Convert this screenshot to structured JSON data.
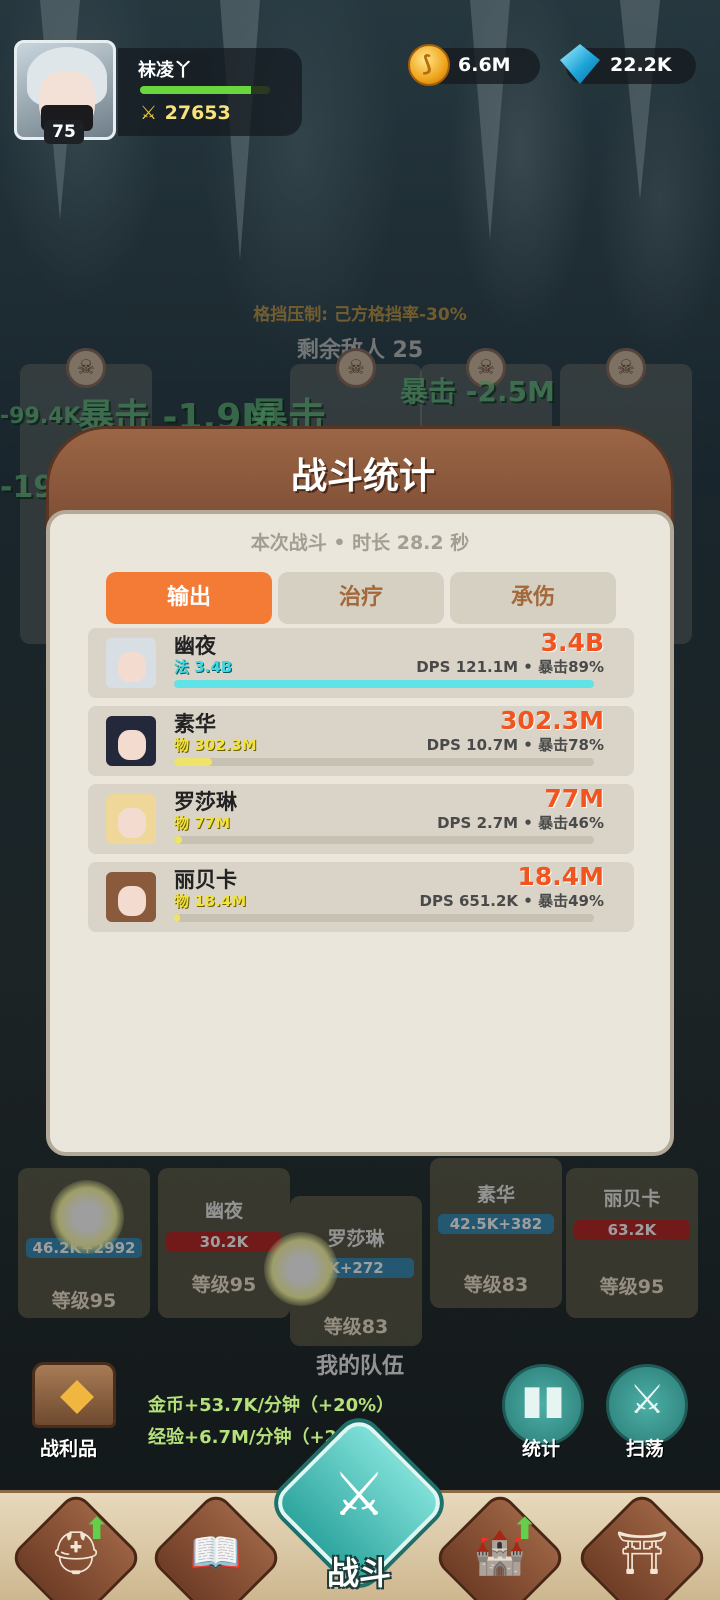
{
  "player": {
    "name": "袜凌丫",
    "level": "75",
    "power": "27653",
    "hp_fraction": 0.85
  },
  "currency": {
    "gold": "6.6M",
    "gems": "22.2K"
  },
  "battle": {
    "suppress_text": "格挡压制: 己方格挡率-30%",
    "enemies_left": "剩余敌人 25",
    "floating": [
      "-99.4K",
      "暴击 -1.9M",
      "暴击",
      "暴击 -2.5M",
      "-19"
    ]
  },
  "modal": {
    "title": "战斗统计",
    "meta": "本次战斗 • 时长 28.2 秒",
    "tabs": [
      {
        "label": "输出",
        "active": true
      },
      {
        "label": "治疗",
        "active": false
      },
      {
        "label": "承伤",
        "active": false
      }
    ],
    "rows": [
      {
        "name": "幽夜",
        "sub": "法 3.4B",
        "total": "3.4B",
        "dps": "DPS 121.1M • 暴击89%",
        "fill": 1.0,
        "bar_color": "#5fe3e6",
        "sub_type": "magic",
        "hair": "#d8dfe4"
      },
      {
        "name": "素华",
        "sub": "物 302.3M",
        "total": "302.3M",
        "dps": "DPS 10.7M • 暴击78%",
        "fill": 0.09,
        "bar_color": "#efe36a",
        "sub_type": "physical",
        "hair": "#23283a"
      },
      {
        "name": "罗莎琳",
        "sub": "物 77M",
        "total": "77M",
        "dps": "DPS 2.7M • 暴击46%",
        "fill": 0.02,
        "bar_color": "#efe36a",
        "sub_type": "physical",
        "hair": "#efd79a"
      },
      {
        "name": "丽贝卡",
        "sub": "物 18.4M",
        "total": "18.4M",
        "dps": "DPS 651.2K • 暴击49%",
        "fill": 0.01,
        "bar_color": "#efe36a",
        "sub_type": "physical",
        "hair": "#8a5a3c"
      }
    ]
  },
  "team": {
    "title": "我的队伍",
    "members": [
      {
        "name": "",
        "hp": "46.2K+2992",
        "level": "等级95",
        "hp_color": "#3a8fb8"
      },
      {
        "name": "幽夜",
        "hp": "30.2K",
        "level": "等级95",
        "hp_color": "#b82a2a"
      },
      {
        "name": "罗莎琳",
        "hp": "K+272",
        "level": "等级83",
        "hp_color": "#3a8fb8"
      },
      {
        "name": "素华",
        "hp": "42.5K+382",
        "level": "等级83",
        "hp_color": "#3a8fb8"
      },
      {
        "name": "丽贝卡",
        "hp": "63.2K",
        "level": "等级95",
        "hp_color": "#b82a2a"
      }
    ]
  },
  "bottom": {
    "loot_label": "战利品",
    "gold_rate": "金币+53.7K/分钟（+20%）",
    "exp_rate": "经验+6.7M/分钟（+20%）",
    "stats_label": "统计",
    "sweep_label": "扫荡",
    "battle_label": "战斗"
  }
}
